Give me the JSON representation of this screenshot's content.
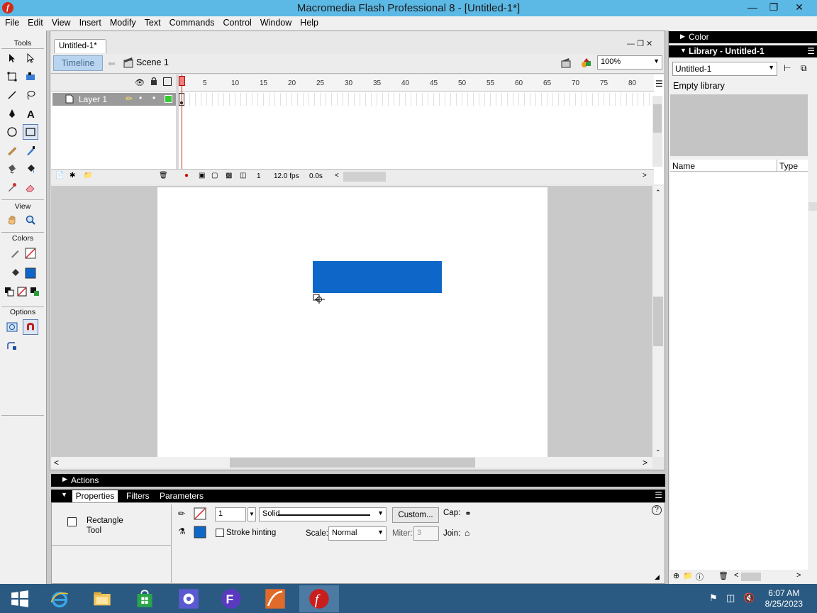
{
  "window": {
    "title": "Macromedia Flash Professional 8 - [Untitled-1*]"
  },
  "menubar": [
    "File",
    "Edit",
    "View",
    "Insert",
    "Modify",
    "Text",
    "Commands",
    "Control",
    "Window",
    "Help"
  ],
  "tools": {
    "header": "Tools",
    "view_header": "View",
    "colors_header": "Colors",
    "options_header": "Options"
  },
  "document": {
    "tab": "Untitled-1*",
    "timeline_button": "Timeline",
    "scene": "Scene 1",
    "zoom": "100%"
  },
  "timeline": {
    "layer_name": "Layer 1",
    "ruler": [
      "1",
      "5",
      "10",
      "15",
      "20",
      "25",
      "30",
      "35",
      "40",
      "45",
      "50",
      "55",
      "60",
      "65",
      "70",
      "75",
      "80"
    ],
    "current_frame": "1",
    "fps": "12.0 fps",
    "elapsed": "0.0s"
  },
  "stage": {
    "shape_color": "#0e67c8"
  },
  "panels": {
    "actions": "Actions",
    "tabs": [
      "Properties",
      "Filters",
      "Parameters"
    ]
  },
  "properties": {
    "tool_name_line1": "Rectangle",
    "tool_name_line2": "Tool",
    "stroke_height": "1",
    "stroke_style": "Solid",
    "custom_button": "Custom...",
    "cap_label": "Cap:",
    "stroke_hinting": "Stroke hinting",
    "scale_label": "Scale:",
    "scale_value": "Normal",
    "miter_label": "Miter:",
    "miter_value": "3",
    "join_label": "Join:"
  },
  "right": {
    "color_header": "Color",
    "library_header": "Library - Untitled-1",
    "library_select": "Untitled-1",
    "empty_text": "Empty library",
    "col_name": "Name",
    "col_type": "Type"
  },
  "taskbar": {
    "time": "6:07 AM",
    "date": "8/25/2023"
  }
}
